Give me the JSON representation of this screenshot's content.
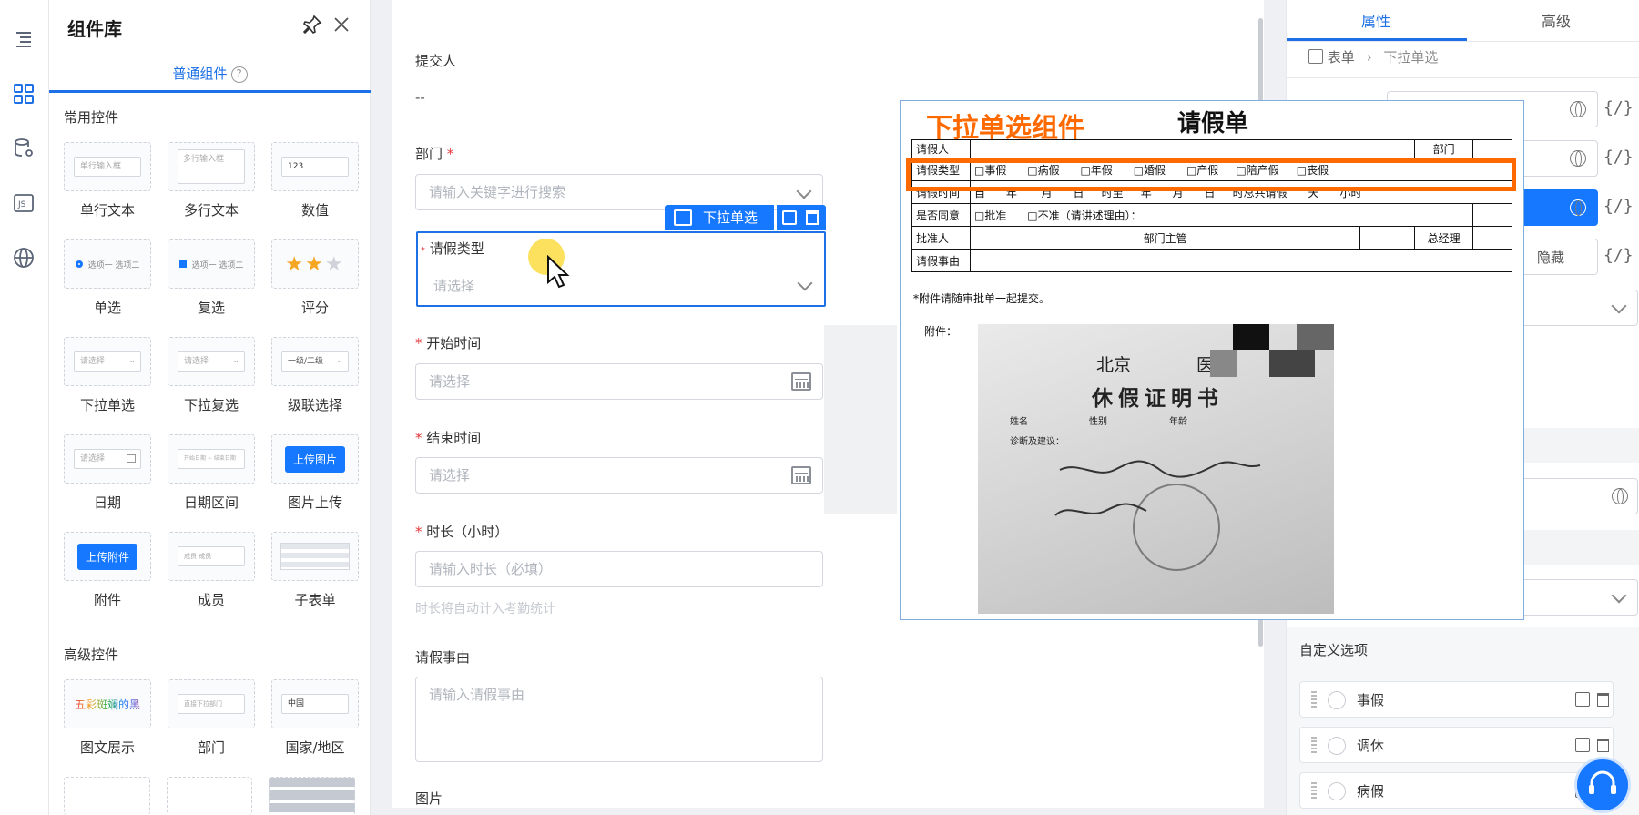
{
  "panel": {
    "title": "组件库",
    "tab": "普通组件",
    "help": "?",
    "section_common": "常用控件",
    "section_advanced": "高级控件",
    "common": [
      {
        "label": "单行文本",
        "preview": "单行输入框"
      },
      {
        "label": "多行文本",
        "preview": "多行输入框"
      },
      {
        "label": "数值",
        "preview": "123"
      },
      {
        "label": "单选",
        "preview": "选项一 选项二"
      },
      {
        "label": "复选",
        "preview": "选项一 选项二"
      },
      {
        "label": "评分",
        "preview": ""
      },
      {
        "label": "下拉单选",
        "preview": "请选择"
      },
      {
        "label": "下拉复选",
        "preview": "请选择"
      },
      {
        "label": "级联选择",
        "preview": "一级/二级"
      },
      {
        "label": "日期",
        "preview": "请选择"
      },
      {
        "label": "日期区间",
        "preview": "开始日期 ~ 结束日期"
      },
      {
        "label": "图片上传",
        "preview": "上传图片"
      },
      {
        "label": "附件",
        "preview": "上传附件"
      },
      {
        "label": "成员",
        "preview": "成员 成员"
      },
      {
        "label": "子表单",
        "preview": ""
      }
    ],
    "advanced": [
      {
        "label": "图文展示",
        "preview": "五彩斑斓的黑"
      },
      {
        "label": "部门",
        "preview": "直接下拉部门"
      },
      {
        "label": "国家/地区",
        "preview": "中国"
      }
    ]
  },
  "form": {
    "submitter_label": "提交人",
    "submitter_value": "--",
    "dept_label": "部门",
    "dept_placeholder": "请输入关键字进行搜索",
    "leave_type_label": "请假类型",
    "leave_type_placeholder": "请选择",
    "selected_tag": "下拉单选",
    "start_label": "开始时间",
    "start_placeholder": "请选择",
    "end_label": "结束时间",
    "end_placeholder": "请选择",
    "duration_label": "时长（小时）",
    "duration_placeholder": "请输入时长（必填）",
    "duration_hint": "时长将自动计入考勤统计",
    "reason_label": "请假事由",
    "reason_placeholder": "请输入请假事由",
    "image_label": "图片",
    "required_mark": "*"
  },
  "right": {
    "tab_props": "属性",
    "tab_advanced": "高级",
    "crumb_root": "表单",
    "crumb_current": "下拉单选",
    "code_label": "{/}",
    "hide_label": "隐藏",
    "custom_options_title": "自定义选项",
    "options": [
      "事假",
      "调休",
      "病假"
    ]
  },
  "overlay": {
    "title": "下拉单选组件",
    "form_title": "请假单",
    "rows": [
      [
        "请假人",
        "",
        "部门",
        ""
      ],
      [
        "请假类型",
        "□事假",
        "□病假",
        "□年假",
        "□婚假",
        "□产假",
        "□陪产假",
        "□丧假"
      ],
      [
        "请假时间",
        "自",
        "年",
        "月",
        "日",
        "时至",
        "年",
        "月",
        "日",
        "时总共请假",
        "天",
        "小时"
      ],
      [
        "是否同意",
        "□批准",
        "□不准（请讲述理由）：",
        ""
      ],
      [
        "批准人",
        "部门主管",
        "",
        "总经理",
        ""
      ],
      [
        "请假事由",
        ""
      ]
    ],
    "note": "*附件请随审批单一起提交。",
    "attach_label": "附件：",
    "photo_text": [
      "北京",
      "医院",
      "休假证明书",
      "姓名",
      "性别",
      "年龄",
      "诊断及建议："
    ]
  },
  "colors": {
    "accent": "#1677ff",
    "highlight": "#ff6a00"
  }
}
